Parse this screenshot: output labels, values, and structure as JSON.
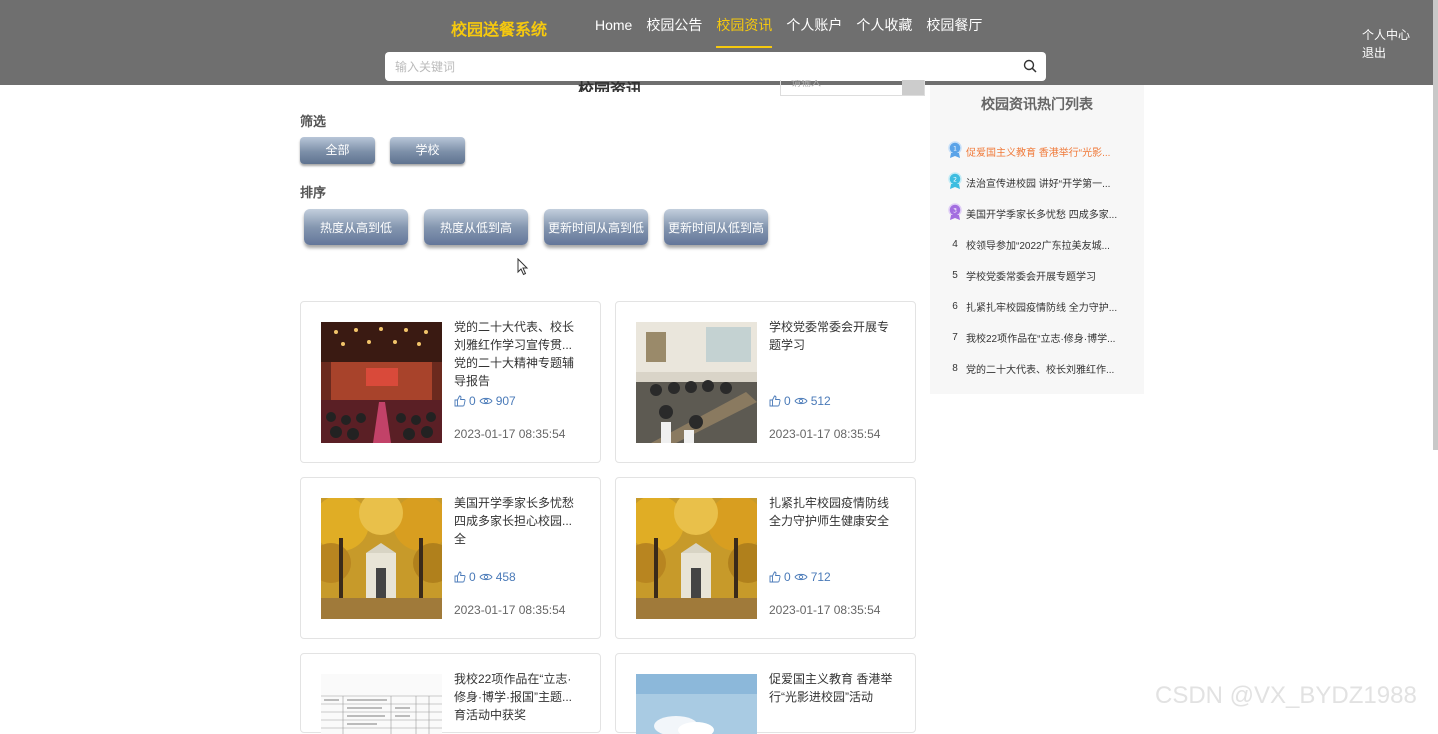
{
  "header": {
    "brand": "校园送餐系统",
    "nav": [
      {
        "label": "Home",
        "active": false
      },
      {
        "label": "校园公告",
        "active": false
      },
      {
        "label": "校园资讯",
        "active": true
      },
      {
        "label": "个人账户",
        "active": false
      },
      {
        "label": "个人收藏",
        "active": false
      },
      {
        "label": "校园餐厅",
        "active": false
      }
    ],
    "user_center": "个人中心",
    "logout": "退出",
    "search_placeholder": "输入关键词"
  },
  "main": {
    "page_title": "校园资讯",
    "mini_search_placeholder": "请输入",
    "filter_label": "筛选",
    "filters": [
      "全部",
      "学校"
    ],
    "sort_label": "排序",
    "sorts": [
      "热度从高到低",
      "热度从低到高",
      "更新时间从高到低",
      "更新时间从低到高"
    ],
    "cards": [
      {
        "title": "党的二十大代表、校长刘雅红作学习宣传贯...党的二十大精神专题辅导报告",
        "likes": "0",
        "views": "907",
        "date": "2023-01-17 08:35:54",
        "image": "auditorium"
      },
      {
        "title": "学校党委常委会开展专题学习",
        "likes": "0",
        "views": "512",
        "date": "2023-01-17 08:35:54",
        "image": "meeting"
      },
      {
        "title": "美国开学季家长多忧愁 四成多家长担心校园...全",
        "likes": "0",
        "views": "458",
        "date": "2023-01-17 08:35:54",
        "image": "campus-autumn"
      },
      {
        "title": "扎紧扎牢校园疫情防线 全力守护师生健康安全",
        "likes": "0",
        "views": "712",
        "date": "2023-01-17 08:35:54",
        "image": "campus-autumn"
      },
      {
        "title": "我校22项作品在“立志·修身·博学·报国”主题...育活动中获奖",
        "likes": "",
        "views": "",
        "date": "",
        "image": "document-table"
      },
      {
        "title": "促爱国主义教育 香港举行“光影进校园”活动",
        "likes": "",
        "views": "",
        "date": "",
        "image": "sky"
      }
    ]
  },
  "sidebar": {
    "title": "校园资讯热门列表",
    "items": [
      {
        "rank": "1",
        "text": "促爱国主义教育 香港举行“光影...",
        "medal": "#5aa3e8"
      },
      {
        "rank": "2",
        "text": "法治宣传进校园 讲好“开学第一...",
        "medal": "#3dbde0"
      },
      {
        "rank": "3",
        "text": "美国开学季家长多忧愁 四成多家...",
        "medal": "#a36ee0"
      },
      {
        "rank": "4",
        "text": "校领导参加“2022广东拉美友城...",
        "medal": ""
      },
      {
        "rank": "5",
        "text": "学校党委常委会开展专题学习",
        "medal": ""
      },
      {
        "rank": "6",
        "text": "扎紧扎牢校园疫情防线 全力守护...",
        "medal": ""
      },
      {
        "rank": "7",
        "text": "我校22项作品在“立志·修身·博学...",
        "medal": ""
      },
      {
        "rank": "8",
        "text": "党的二十大代表、校长刘雅红作...",
        "medal": ""
      }
    ]
  },
  "watermark": "CSDN @VX_BYDZ1988",
  "colors": {
    "topbar": "#6f6f6f",
    "accent": "#f6c90e",
    "hot_first": "#f07a3a",
    "stats": "#4a7ab8"
  }
}
